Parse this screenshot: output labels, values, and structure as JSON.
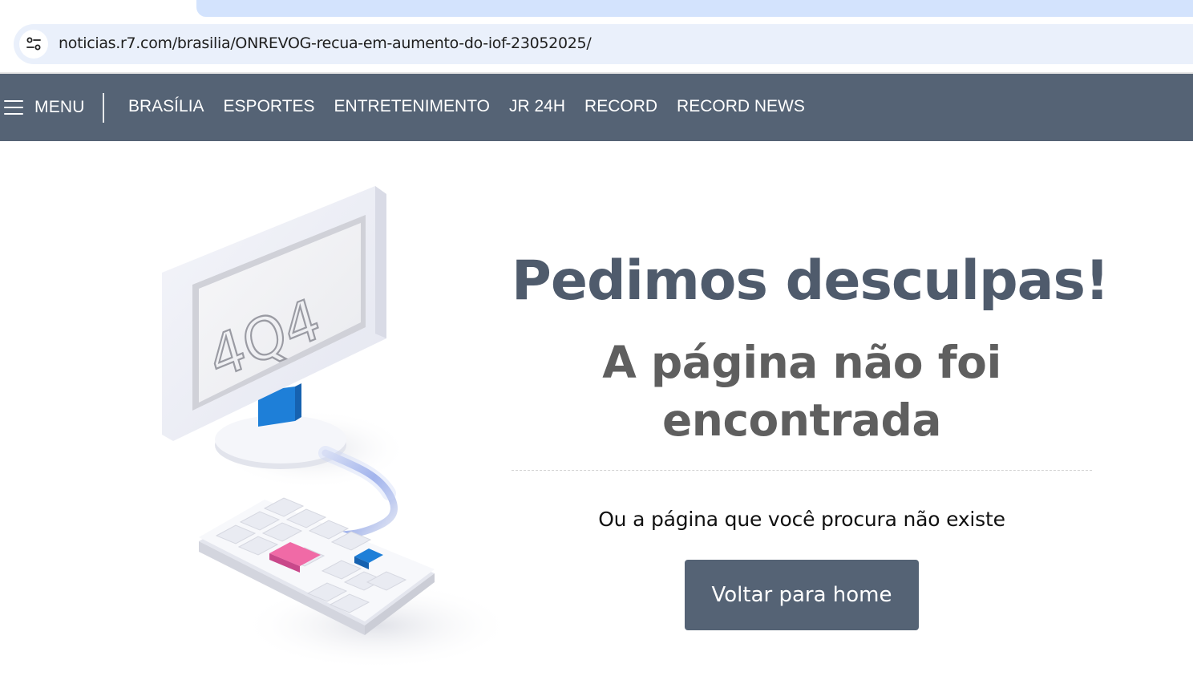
{
  "browser": {
    "url": "noticias.r7.com/brasilia/ONREVOG-recua-em-aumento-do-iof-23052025/",
    "site_info_icon": "tune-icon"
  },
  "nav": {
    "menu_label": "MENU",
    "links": [
      "BRASÍLIA",
      "ESPORTES",
      "ENTRETENIMENTO",
      "JR 24H",
      "RECORD",
      "RECORD NEWS"
    ],
    "background": "#556375"
  },
  "error_page": {
    "screen_text": "4Q4",
    "headline": "Pedimos desculpas!",
    "subheadline": "A página não foi encontrada",
    "message": "Ou a página que você procura não existe",
    "button_label": "Voltar para home",
    "headline_color": "#4f5b6c",
    "subheadline_color": "#5f5f5f"
  }
}
